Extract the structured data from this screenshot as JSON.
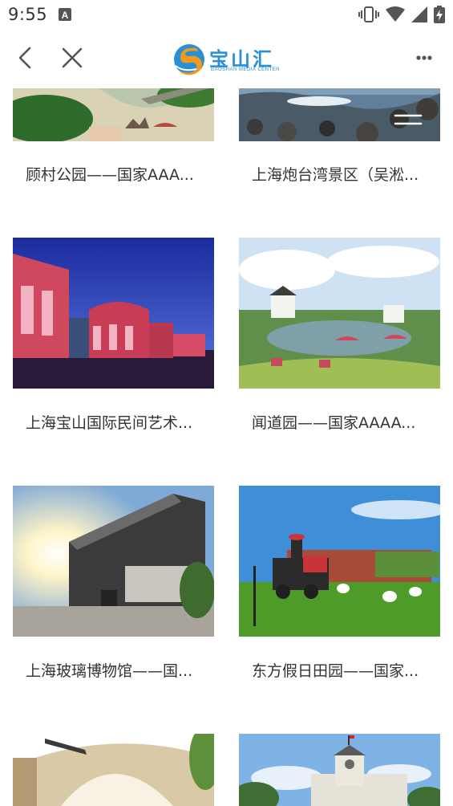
{
  "status_bar": {
    "time": "9:55",
    "icons": [
      "a-notification-icon",
      "vibrate-icon",
      "wifi-icon",
      "signal-icon",
      "battery-charging-icon"
    ]
  },
  "header": {
    "brand_name": "宝山汇",
    "brand_subtitle": "BAOSHAN MEDIA CENTER",
    "icons": [
      "back-arrow-icon",
      "close-icon",
      "more-icon"
    ]
  },
  "colors": {
    "brand_blue": "#2a8fd6",
    "brand_orange": "#f29a1c",
    "text": "#333333",
    "background": "#ffffff"
  },
  "cards": [
    {
      "title": "顾村公园——国家AAA..."
    },
    {
      "title": "上海炮台湾景区（吴淞..."
    },
    {
      "title": "上海宝山国际民间艺术..."
    },
    {
      "title": "闻道园——国家AAAA..."
    },
    {
      "title": "上海玻璃博物馆——国..."
    },
    {
      "title": "东方假日田园——国家..."
    },
    {
      "title": ""
    },
    {
      "title": ""
    }
  ]
}
